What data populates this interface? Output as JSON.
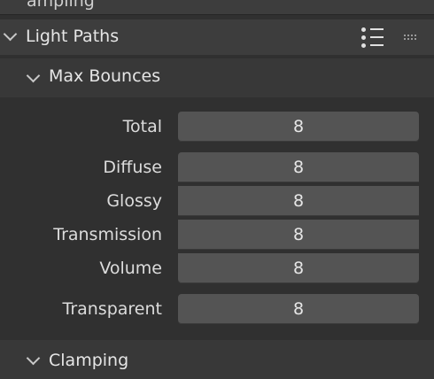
{
  "previous_panel": {
    "title_fragment": "ampling"
  },
  "light_paths": {
    "title": "Light Paths",
    "list_icon": "list-presets-icon",
    "drag_icon": "drag-handle-icon"
  },
  "max_bounces": {
    "title": "Max Bounces",
    "fields": [
      {
        "label": "Total",
        "value": "8"
      },
      {
        "label": "Diffuse",
        "value": "8"
      },
      {
        "label": "Glossy",
        "value": "8"
      },
      {
        "label": "Transmission",
        "value": "8"
      },
      {
        "label": "Volume",
        "value": "8"
      },
      {
        "label": "Transparent",
        "value": "8"
      }
    ]
  },
  "clamping": {
    "title": "Clamping"
  }
}
